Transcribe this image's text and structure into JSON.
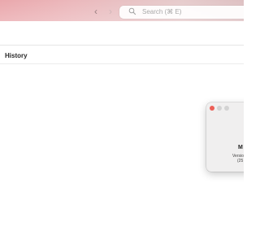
{
  "toolbar": {
    "back_label": "‹",
    "forward_label": "›",
    "search_placeholder": "Search (⌘ E)"
  },
  "main": {
    "section_title": "History"
  },
  "about_dialog": {
    "app_name_visible": "M",
    "version_visible": "Versio",
    "build_visible": "(25"
  },
  "colors": {
    "close_button": "#ec5f57",
    "inactive_button": "#d3d3d3",
    "wallpaper_accent": "#e9a3a8"
  },
  "icons": {
    "search": "search-icon",
    "back": "chevron-left-icon",
    "forward": "chevron-right-icon"
  }
}
